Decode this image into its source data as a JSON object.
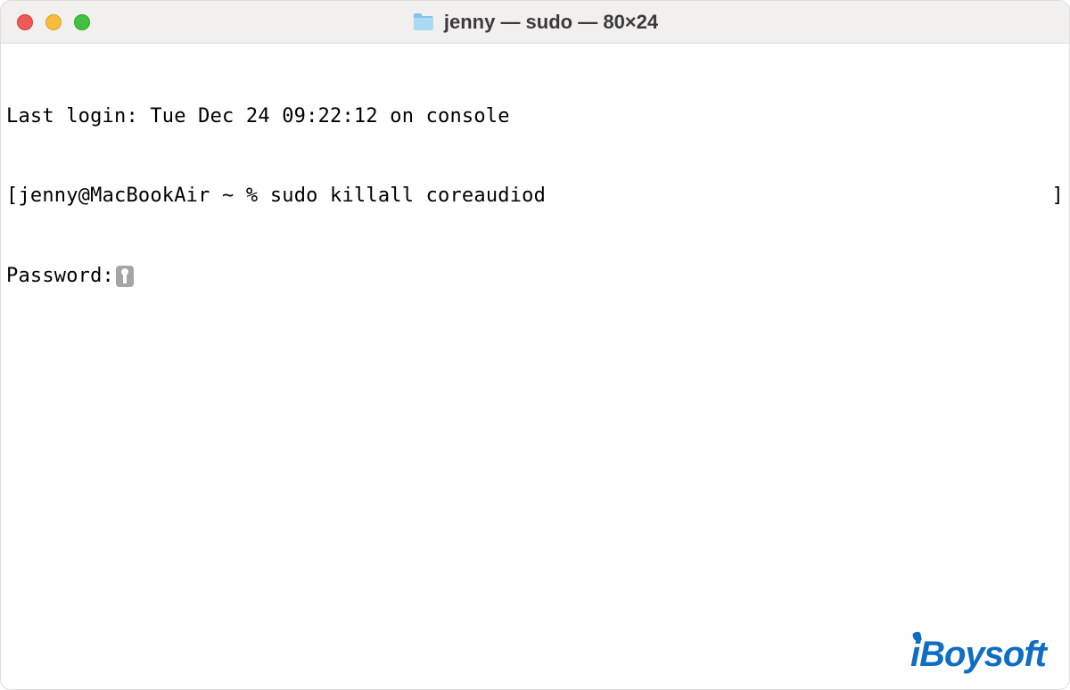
{
  "titlebar": {
    "title": "jenny — sudo — 80×24"
  },
  "terminal": {
    "last_login": "Last login: Tue Dec 24 09:22:12 on console",
    "prompt_left_bracket": "[",
    "prompt_user_host": "jenny@MacBookAir ~ % ",
    "command": "sudo killall coreaudiod",
    "prompt_right_bracket": "]",
    "password_label": "Password:"
  },
  "watermark": {
    "text_i": "i",
    "text_rest": "Boysoft"
  }
}
